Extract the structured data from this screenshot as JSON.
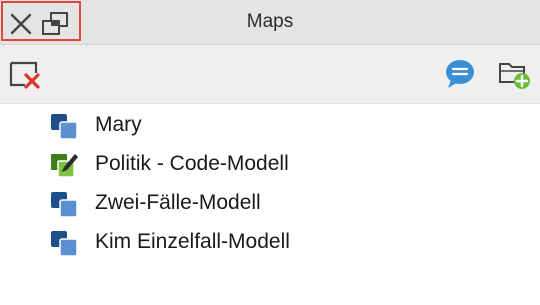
{
  "window": {
    "title": "Maps",
    "close_icon": "close-icon",
    "undock_icon": "undock-window-icon",
    "highlight_color": "#e2483a"
  },
  "toolbar": {
    "delete_icon": "delete-map-icon",
    "memo_icon": "memo-speech-bubble-icon",
    "new_folder_icon": "new-folder-icon",
    "memo_color": "#3a8fd6",
    "add_color": "#6abf3a",
    "delete_color": "#d9352a"
  },
  "maps": {
    "items": [
      {
        "label": "Mary",
        "icon": "map-stack-icon"
      },
      {
        "label": "Politik - Code-Modell",
        "icon": "code-model-icon"
      },
      {
        "label": "Zwei-Fälle-Modell",
        "icon": "map-stack-icon"
      },
      {
        "label": "Kim Einzelfall-Modell",
        "icon": "map-stack-icon"
      }
    ]
  }
}
